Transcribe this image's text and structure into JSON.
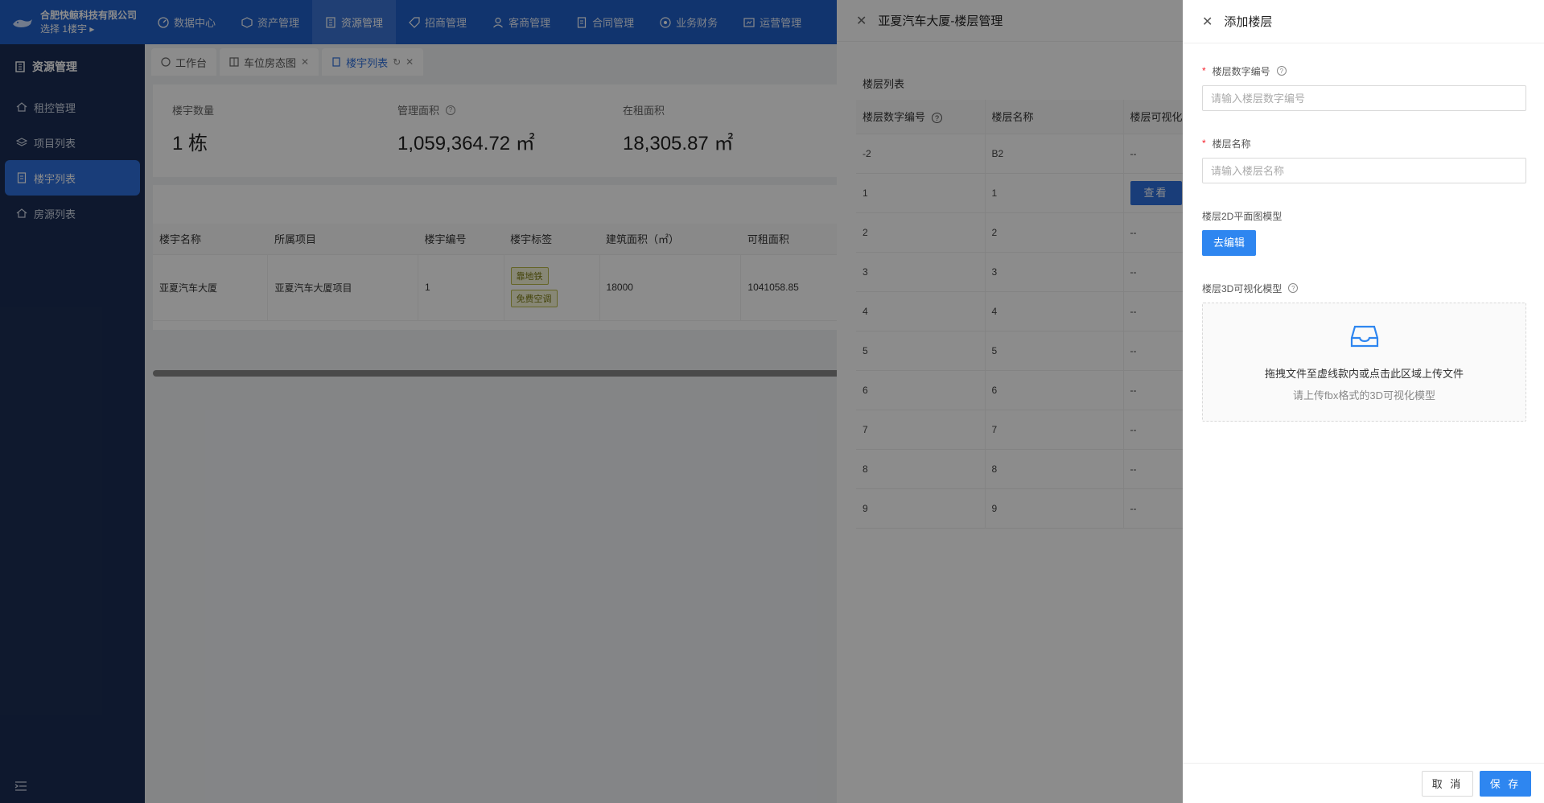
{
  "brand": {
    "company": "合肥快鲸科技有限公司",
    "selector": "选择 1楼宇 ▸"
  },
  "nav": [
    {
      "label": "数据中心",
      "icon": "dashboard-icon"
    },
    {
      "label": "资产管理",
      "icon": "cube-icon"
    },
    {
      "label": "资源管理",
      "icon": "building-icon",
      "active": true
    },
    {
      "label": "招商管理",
      "icon": "tag-icon"
    },
    {
      "label": "客商管理",
      "icon": "user-icon"
    },
    {
      "label": "合同管理",
      "icon": "document-icon"
    },
    {
      "label": "业务财务",
      "icon": "finance-icon"
    },
    {
      "label": "运营管理",
      "icon": "operations-icon"
    }
  ],
  "sidebar": {
    "title": "资源管理",
    "items": [
      {
        "label": "租控管理"
      },
      {
        "label": "项目列表"
      },
      {
        "label": "楼宇列表",
        "active": true
      },
      {
        "label": "房源列表"
      }
    ]
  },
  "tabs": [
    {
      "label": "工作台"
    },
    {
      "label": "车位房态图"
    },
    {
      "label": "楼宇列表",
      "active": true
    }
  ],
  "stats": [
    {
      "label": "楼宇数量",
      "value": "1 栋"
    },
    {
      "label": "管理面积",
      "value": "1,059,364.72 ㎡"
    },
    {
      "label": "在租面积",
      "value": "18,305.87 ㎡"
    }
  ],
  "building_table": {
    "headers": [
      "楼宇名称",
      "所属项目",
      "楼宇编号",
      "楼宇标签",
      "建筑面积（㎡）",
      "可租面积"
    ],
    "row": {
      "name": "亚夏汽车大厦",
      "project": "亚夏汽车大厦项目",
      "code": "1",
      "tags": [
        "靠地铁",
        "免费空调"
      ],
      "area": "18000",
      "rentable": "1041058.85"
    }
  },
  "floor_drawer": {
    "title": "亚夏汽车大厦-楼层管理",
    "section": "楼层列表",
    "headers": [
      "楼层数字编号",
      "楼层名称",
      "楼层可视化"
    ],
    "rows": [
      {
        "num": "-2",
        "name": "B2",
        "vis": "--"
      },
      {
        "num": "1",
        "name": "1",
        "vis": "查看"
      },
      {
        "num": "2",
        "name": "2",
        "vis": "--"
      },
      {
        "num": "3",
        "name": "3",
        "vis": "--"
      },
      {
        "num": "4",
        "name": "4",
        "vis": "--"
      },
      {
        "num": "5",
        "name": "5",
        "vis": "--"
      },
      {
        "num": "6",
        "name": "6",
        "vis": "--"
      },
      {
        "num": "7",
        "name": "7",
        "vis": "--"
      },
      {
        "num": "8",
        "name": "8",
        "vis": "--"
      },
      {
        "num": "9",
        "name": "9",
        "vis": "--"
      }
    ]
  },
  "add_floor": {
    "title": "添加楼层",
    "num_label": "楼层数字编号",
    "num_placeholder": "请输入楼层数字编号",
    "name_label": "楼层名称",
    "name_placeholder": "请输入楼层名称",
    "plan_label": "楼层2D平面图模型",
    "edit_button": "去编辑",
    "model_label": "楼层3D可视化模型",
    "upload_text": "拖拽文件至虚线款内或点击此区域上传文件",
    "upload_hint": "请上传fbx格式的3D可视化模型",
    "cancel": "取 消",
    "save": "保 存"
  },
  "colors": {
    "primary": "#2e86f0",
    "nav_bg": "#1f5fc8",
    "sidebar_bg": "#1b2d54",
    "required": "#f5222d"
  }
}
